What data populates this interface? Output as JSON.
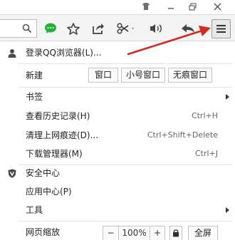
{
  "toolbar": {
    "menu_icon": "hamburger-menu-icon",
    "icons": [
      "search-icon",
      "chat-bubble-icon",
      "star-icon",
      "share-icon",
      "scissors-icon",
      "speaker-icon",
      "back-arrow-icon"
    ]
  },
  "menu": {
    "login": "登录QQ浏览器(L)...",
    "new_label": "新建",
    "new_window": "窗口",
    "new_small_window": "小号窗口",
    "new_incognito": "无痕窗口",
    "bookmarks": "书签",
    "history": "查看历史记录(H)",
    "history_shortcut": "Ctrl+H",
    "clear": "清理上网痕迹(D)...",
    "clear_shortcut": "Ctrl+Shift+Delete",
    "downloads": "下载管理器(M)",
    "downloads_shortcut": "Ctrl+J",
    "security": "安全中心",
    "apps": "应用中心(P)",
    "tools": "工具",
    "zoom_label": "网页缩放",
    "zoom_minus": "−",
    "zoom_value": "100%",
    "zoom_plus": "+",
    "fullscreen": "全屏"
  },
  "colors": {
    "annotation_arrow": "#d42a22",
    "chat_icon": "#22b035"
  }
}
